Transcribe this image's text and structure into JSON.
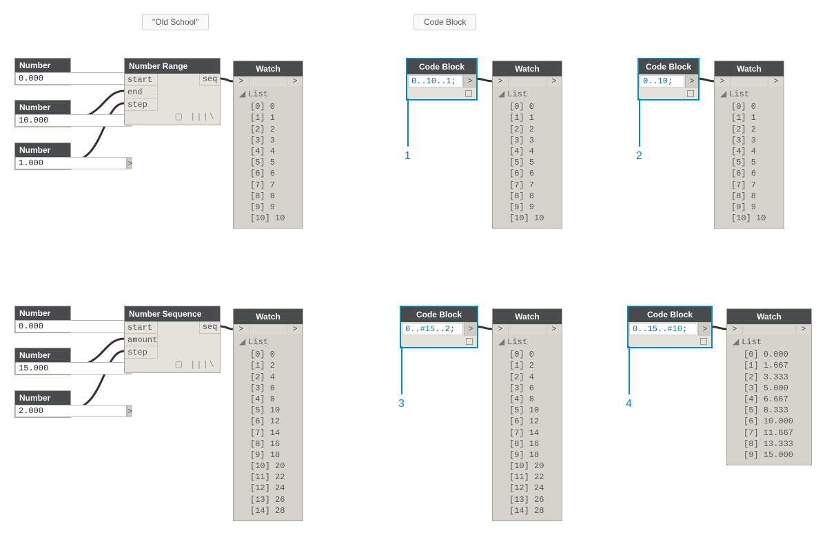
{
  "headings": {
    "old_school": "\"Old School\"",
    "code_block": "Code Block"
  },
  "labels": {
    "number": "Number",
    "number_range": "Number Range",
    "number_sequence": "Number Sequence",
    "watch": "Watch",
    "code_block": "Code Block",
    "start": "start",
    "end": "end",
    "step": "step",
    "amount": "amount",
    "seq": "seq",
    "list": "List",
    "port": ">"
  },
  "top": {
    "numbers": {
      "a": "0.000",
      "b": "10.000",
      "c": "1.000"
    },
    "watch1": {
      "rows": [
        "[0] 0",
        "[1] 1",
        "[2] 2",
        "[3] 3",
        "[4] 4",
        "[5] 5",
        "[6] 6",
        "[7] 7",
        "[8] 8",
        "[9] 9",
        "[10] 10"
      ]
    },
    "cb1": {
      "code_html": "<span class='blue'>0</span>..<span class='blue'>10</span>..<span class='blue'>1</span>;",
      "watch": {
        "rows": [
          "[0] 0",
          "[1] 1",
          "[2] 2",
          "[3] 3",
          "[4] 4",
          "[5] 5",
          "[6] 6",
          "[7] 7",
          "[8] 8",
          "[9] 9",
          "[10] 10"
        ]
      }
    },
    "cb2": {
      "code_html": "<span class='blue'>0</span>..<span class='blue'>10</span>;",
      "watch": {
        "rows": [
          "[0] 0",
          "[1] 1",
          "[2] 2",
          "[3] 3",
          "[4] 4",
          "[5] 5",
          "[6] 6",
          "[7] 7",
          "[8] 8",
          "[9] 9",
          "[10] 10"
        ]
      }
    }
  },
  "bottom": {
    "numbers": {
      "a": "0.000",
      "b": "15.000",
      "c": "2.000"
    },
    "watch1": {
      "rows": [
        "[0] 0",
        "[1] 2",
        "[2] 4",
        "[3] 6",
        "[4] 8",
        "[5] 10",
        "[6] 12",
        "[7] 14",
        "[8] 16",
        "[9] 18",
        "[10] 20",
        "[11] 22",
        "[12] 24",
        "[13] 26",
        "[14] 28"
      ]
    },
    "cb3": {
      "code_html": "<span class='blue'>0</span>..<span class='teal'>#15</span>..<span class='blue'>2</span>;",
      "watch": {
        "rows": [
          "[0] 0",
          "[1] 2",
          "[2] 4",
          "[3] 6",
          "[4] 8",
          "[5] 10",
          "[6] 12",
          "[7] 14",
          "[8] 16",
          "[9] 18",
          "[10] 20",
          "[11] 22",
          "[12] 24",
          "[13] 26",
          "[14] 28"
        ]
      }
    },
    "cb4": {
      "code_html": "<span class='blue'>0</span>..<span class='blue'>15</span>..<span class='teal'>#10</span>;",
      "watch": {
        "rows": [
          "[0] 0.000",
          "[1] 1.667",
          "[2] 3.333",
          "[3] 5.000",
          "[4] 6.667",
          "[5] 8.333",
          "[6] 10.000",
          "[7] 11.667",
          "[8] 13.333",
          "[9] 15.000"
        ]
      }
    }
  },
  "callouts": {
    "c1": "1",
    "c2": "2",
    "c3": "3",
    "c4": "4"
  }
}
